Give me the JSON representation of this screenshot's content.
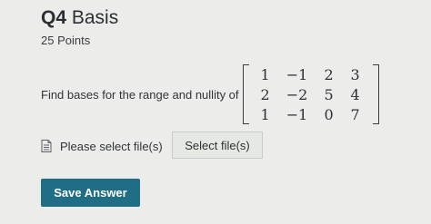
{
  "question": {
    "number": "Q4",
    "title": "Basis",
    "points": "25 Points",
    "prompt": "Find bases for the range and nullity of",
    "matrix": [
      [
        "1",
        "−1",
        "2",
        "3"
      ],
      [
        "2",
        "−2",
        "5",
        "4"
      ],
      [
        "1",
        "−1",
        "0",
        "7"
      ]
    ]
  },
  "upload": {
    "label": "Please select file(s)",
    "button_label": "Select file(s)",
    "icon": "file-icon"
  },
  "actions": {
    "save_label": "Save Answer",
    "save_color": "#1f6e86"
  }
}
